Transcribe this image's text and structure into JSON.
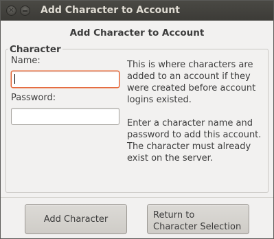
{
  "window": {
    "title": "Add Character to Account"
  },
  "dialog": {
    "header": "Add Character to Account",
    "frame_label": "Character",
    "name_label": "Name:",
    "name_value": "",
    "password_label": "Password:",
    "password_value": "",
    "info_paragraph_1": [
      "This is where characters are",
      "added to an account if they",
      "were created before account",
      "logins existed."
    ],
    "info_paragraph_2": [
      "Enter a character name and",
      "password to add this account.",
      "The character must already",
      "exist on the server."
    ]
  },
  "buttons": {
    "add_label": "Add Character",
    "return_label_lines": [
      "Return to",
      "Character Selection"
    ]
  },
  "colors": {
    "titlebar": "#3c3b37",
    "title_text": "#dfdbd2",
    "window_bg": "#f2f1f0",
    "focus_border": "#e25e2e"
  }
}
